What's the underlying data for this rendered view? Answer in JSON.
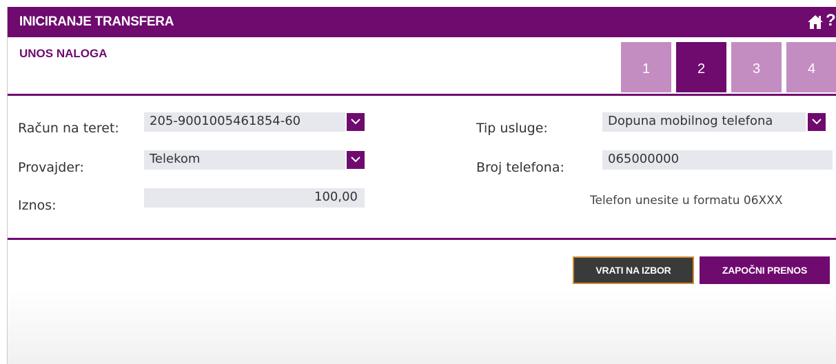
{
  "header": {
    "title": "INICIRANJE TRANSFERA",
    "home_icon": "home-icon",
    "help_label": "?"
  },
  "subtitle": "UNOS NALOGA",
  "steps": [
    {
      "label": "1",
      "active": false
    },
    {
      "label": "2",
      "active": true
    },
    {
      "label": "3",
      "active": false
    },
    {
      "label": "4",
      "active": false
    }
  ],
  "form": {
    "account": {
      "label": "Račun na teret:",
      "value": "205-9001005461854-60"
    },
    "provider": {
      "label": "Provajder:",
      "value": "Telekom"
    },
    "amount": {
      "label": "Iznos:",
      "value": "100,00"
    },
    "service_type": {
      "label": "Tip usluge:",
      "value": "Dopuna mobilnog telefona"
    },
    "phone": {
      "label": "Broj telefona:",
      "value": "065000000"
    },
    "phone_hint": "Telefon unesite u formatu 06XXX"
  },
  "buttons": {
    "back": "VRATI NA IZBOR",
    "start": "ZAPOČNI PRENOS"
  },
  "colors": {
    "brand": "#6f0a6f",
    "step_inactive": "#c48dc2",
    "field_bg": "#e6e8ee",
    "back_button": "#3a3a3a",
    "back_button_border": "#d08a30"
  }
}
